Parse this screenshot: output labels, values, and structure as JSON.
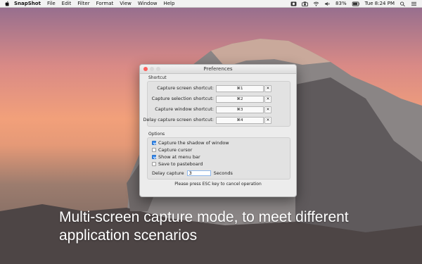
{
  "menubar": {
    "app_name": "SnapShot",
    "items": [
      "File",
      "Edit",
      "Filter",
      "Format",
      "View",
      "Window",
      "Help"
    ],
    "battery": "83%",
    "clock": "Tue 8:24 PM"
  },
  "window": {
    "title": "Preferences",
    "shortcut_section": "Shortcut",
    "shortcuts": [
      {
        "label": "Capture screen shortcut:",
        "value": "⌘1"
      },
      {
        "label": "Capture selection shortcut:",
        "value": "⌘2"
      },
      {
        "label": "Capture window shortcut:",
        "value": "⌘3"
      },
      {
        "label": "Delay capture screen shortcut:",
        "value": "⌘4"
      }
    ],
    "clear_glyph": "✕",
    "options_section": "Options",
    "options": [
      {
        "label": "Capture the shadow of window",
        "checked": true
      },
      {
        "label": "Capture cursor",
        "checked": false
      },
      {
        "label": "Show at menu bar",
        "checked": true
      },
      {
        "label": "Save to pasteboard",
        "checked": false
      }
    ],
    "delay_label": "Delay capture",
    "delay_value": "3",
    "delay_unit": "Seconds",
    "footer_note": "Please press ESC key to cancel operation"
  },
  "caption": {
    "line1": "Multi-screen capture mode, to meet different",
    "line2": "application scenarios"
  },
  "colors": {
    "checkbox_checked": "#3b8ef0",
    "close_button": "#fc605c"
  }
}
